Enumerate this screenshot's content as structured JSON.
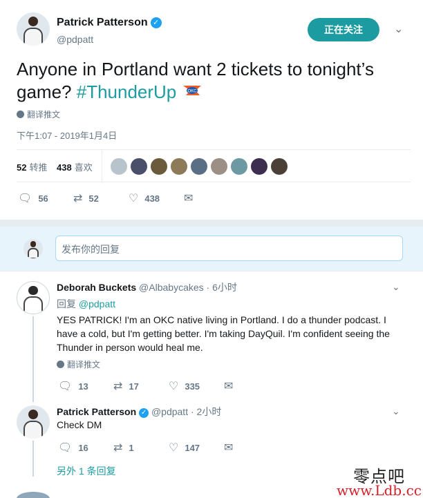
{
  "main_tweet": {
    "author_name": "Patrick Patterson",
    "author_handle": "@pdpatt",
    "follow_label": "正在关注",
    "text_plain": "Anyone in Portland want 2 tickets to tonight’s game?",
    "hashtag": "#ThunderUp",
    "translate_label": "翻译推文",
    "timestamp": "下午1:07 - 2019年1月4日",
    "retweets_count": "52",
    "retweets_label": "转推",
    "likes_count": "438",
    "likes_label": "喜欢",
    "reply_count": "56",
    "retweet_count": "52",
    "like_count": "438"
  },
  "reply_box": {
    "placeholder": "发布你的回复"
  },
  "replies": [
    {
      "name": "Deborah Buckets",
      "handle": "@Albabycakes",
      "time": "· 6小时",
      "reply_to_prefix": "回复",
      "reply_to_mention": "@pdpatt",
      "text": "YES PATRICK! I'm an OKC native living in Portland. I do a thunder podcast. I have a cold, but I'm getting better. I'm taking DayQuil. I'm confident seeing the Thunder in person would heal me.",
      "translate_label": "翻译推文",
      "reply_count": "13",
      "retweet_count": "17",
      "like_count": "335"
    },
    {
      "name": "Patrick Patterson",
      "handle": "@pdpatt",
      "time": "· 2小时",
      "text": "Check DM",
      "reply_count": "16",
      "retweet_count": "1",
      "like_count": "147"
    }
  ],
  "more_replies_label": "另外 1 条回复",
  "watermark": {
    "text_cn": "零点吧",
    "url": "www.Ldb.cc"
  },
  "colors": {
    "accent": "#1c9ca0",
    "secondary_text": "#657786",
    "divider": "#e6ecf0"
  },
  "icons": [
    "verified-icon",
    "caret-down-icon",
    "globe-icon",
    "reply-icon",
    "retweet-icon",
    "heart-icon",
    "message-icon",
    "okc-thunder-emoji"
  ]
}
